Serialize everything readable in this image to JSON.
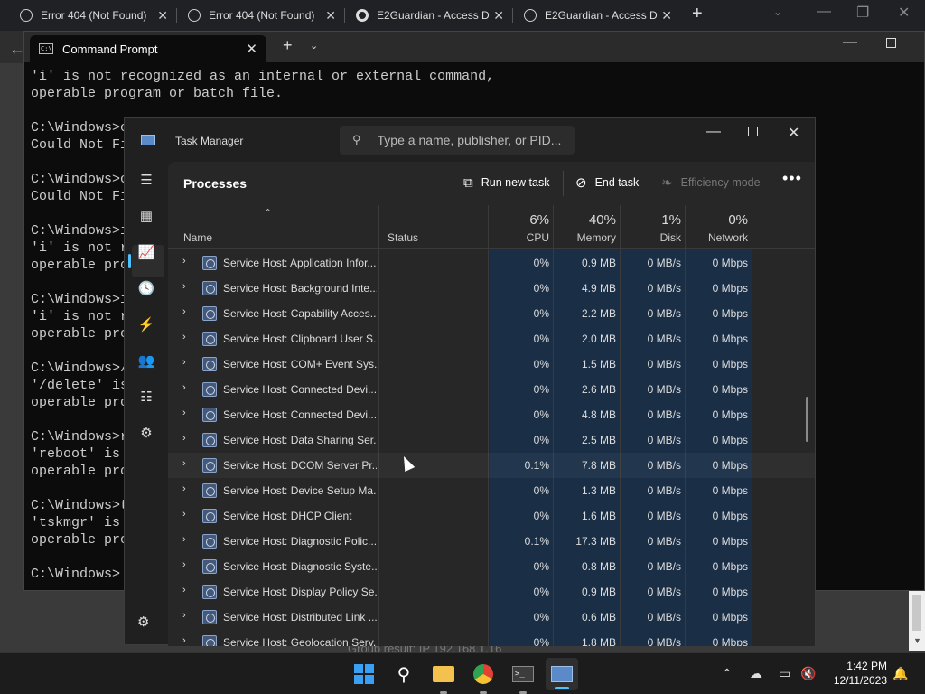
{
  "browser": {
    "tabs": [
      {
        "title": "Error 404 (Not Found)"
      },
      {
        "title": "Error 404 (Not Found)"
      },
      {
        "title": "E2Guardian - Access D"
      },
      {
        "title": "E2Guardian - Access D"
      }
    ],
    "new_tab_glyph": "+",
    "background_text": "Group result: IP 192.168.1.16"
  },
  "cmd": {
    "tab_title": "Command Prompt",
    "lines": [
      "'i' is not recognized as an internal or external command,",
      "operable program or batch file.",
      "",
      "C:\\Windows>c",
      "Could Not Fi",
      "",
      "C:\\Windows>c",
      "Could Not Fi",
      "",
      "C:\\Windows>i",
      "'i' is not r",
      "operable pro",
      "",
      "C:\\Windows>i",
      "'i' is not r",
      "operable pro",
      "",
      "C:\\Windows>/",
      "'/delete' is",
      "operable pro",
      "",
      "C:\\Windows>r",
      "'reboot' is",
      "operable pro",
      "",
      "C:\\Windows>t",
      "'tskmgr' is",
      "operable pro",
      "",
      "C:\\Windows>"
    ]
  },
  "taskmgr": {
    "title": "Task Manager",
    "search_placeholder": "Type a name, publisher, or PID...",
    "page_title": "Processes",
    "toolbar": {
      "run_new_task": "Run new task",
      "end_task": "End task",
      "efficiency_mode": "Efficiency mode"
    },
    "columns": {
      "name": "Name",
      "status": "Status",
      "cpu_pct": "6%",
      "cpu": "CPU",
      "memory_pct": "40%",
      "memory": "Memory",
      "disk_pct": "1%",
      "disk": "Disk",
      "network_pct": "0%",
      "network": "Network"
    },
    "rows": [
      {
        "name": "Service Host: Application Infor...",
        "cpu": "0%",
        "memory": "0.9 MB",
        "disk": "0 MB/s",
        "network": "0 Mbps"
      },
      {
        "name": "Service Host: Background Inte...",
        "cpu": "0%",
        "memory": "4.9 MB",
        "disk": "0 MB/s",
        "network": "0 Mbps"
      },
      {
        "name": "Service Host: Capability Acces...",
        "cpu": "0%",
        "memory": "2.2 MB",
        "disk": "0 MB/s",
        "network": "0 Mbps"
      },
      {
        "name": "Service Host: Clipboard User S...",
        "cpu": "0%",
        "memory": "2.0 MB",
        "disk": "0 MB/s",
        "network": "0 Mbps"
      },
      {
        "name": "Service Host: COM+ Event Sys...",
        "cpu": "0%",
        "memory": "1.5 MB",
        "disk": "0 MB/s",
        "network": "0 Mbps"
      },
      {
        "name": "Service Host: Connected Devi...",
        "cpu": "0%",
        "memory": "2.6 MB",
        "disk": "0 MB/s",
        "network": "0 Mbps"
      },
      {
        "name": "Service Host: Connected Devi...",
        "cpu": "0%",
        "memory": "4.8 MB",
        "disk": "0 MB/s",
        "network": "0 Mbps"
      },
      {
        "name": "Service Host: Data Sharing Ser...",
        "cpu": "0%",
        "memory": "2.5 MB",
        "disk": "0 MB/s",
        "network": "0 Mbps"
      },
      {
        "name": "Service Host: DCOM Server Pr...",
        "cpu": "0.1%",
        "memory": "7.8 MB",
        "disk": "0 MB/s",
        "network": "0 Mbps"
      },
      {
        "name": "Service Host: Device Setup Ma...",
        "cpu": "0%",
        "memory": "1.3 MB",
        "disk": "0 MB/s",
        "network": "0 Mbps"
      },
      {
        "name": "Service Host: DHCP Client",
        "cpu": "0%",
        "memory": "1.6 MB",
        "disk": "0 MB/s",
        "network": "0 Mbps"
      },
      {
        "name": "Service Host: Diagnostic Polic...",
        "cpu": "0.1%",
        "memory": "17.3 MB",
        "disk": "0 MB/s",
        "network": "0 Mbps"
      },
      {
        "name": "Service Host: Diagnostic Syste...",
        "cpu": "0%",
        "memory": "0.8 MB",
        "disk": "0 MB/s",
        "network": "0 Mbps"
      },
      {
        "name": "Service Host: Display Policy Se...",
        "cpu": "0%",
        "memory": "0.9 MB",
        "disk": "0 MB/s",
        "network": "0 Mbps"
      },
      {
        "name": "Service Host: Distributed Link ...",
        "cpu": "0%",
        "memory": "0.6 MB",
        "disk": "0 MB/s",
        "network": "0 Mbps"
      },
      {
        "name": "Service Host: Geolocation Serv...",
        "cpu": "0%",
        "memory": "1.8 MB",
        "disk": "0 MB/s",
        "network": "0 Mbps"
      }
    ],
    "heat_color": "#1a2e46"
  },
  "taskbar": {
    "time": "1:42 PM",
    "date": "12/11/2023",
    "accent": "#4cc2ff"
  },
  "icons": {
    "search": "search-icon",
    "close": "close-icon",
    "minimize": "minimize-icon",
    "maximize": "maximize-icon"
  }
}
